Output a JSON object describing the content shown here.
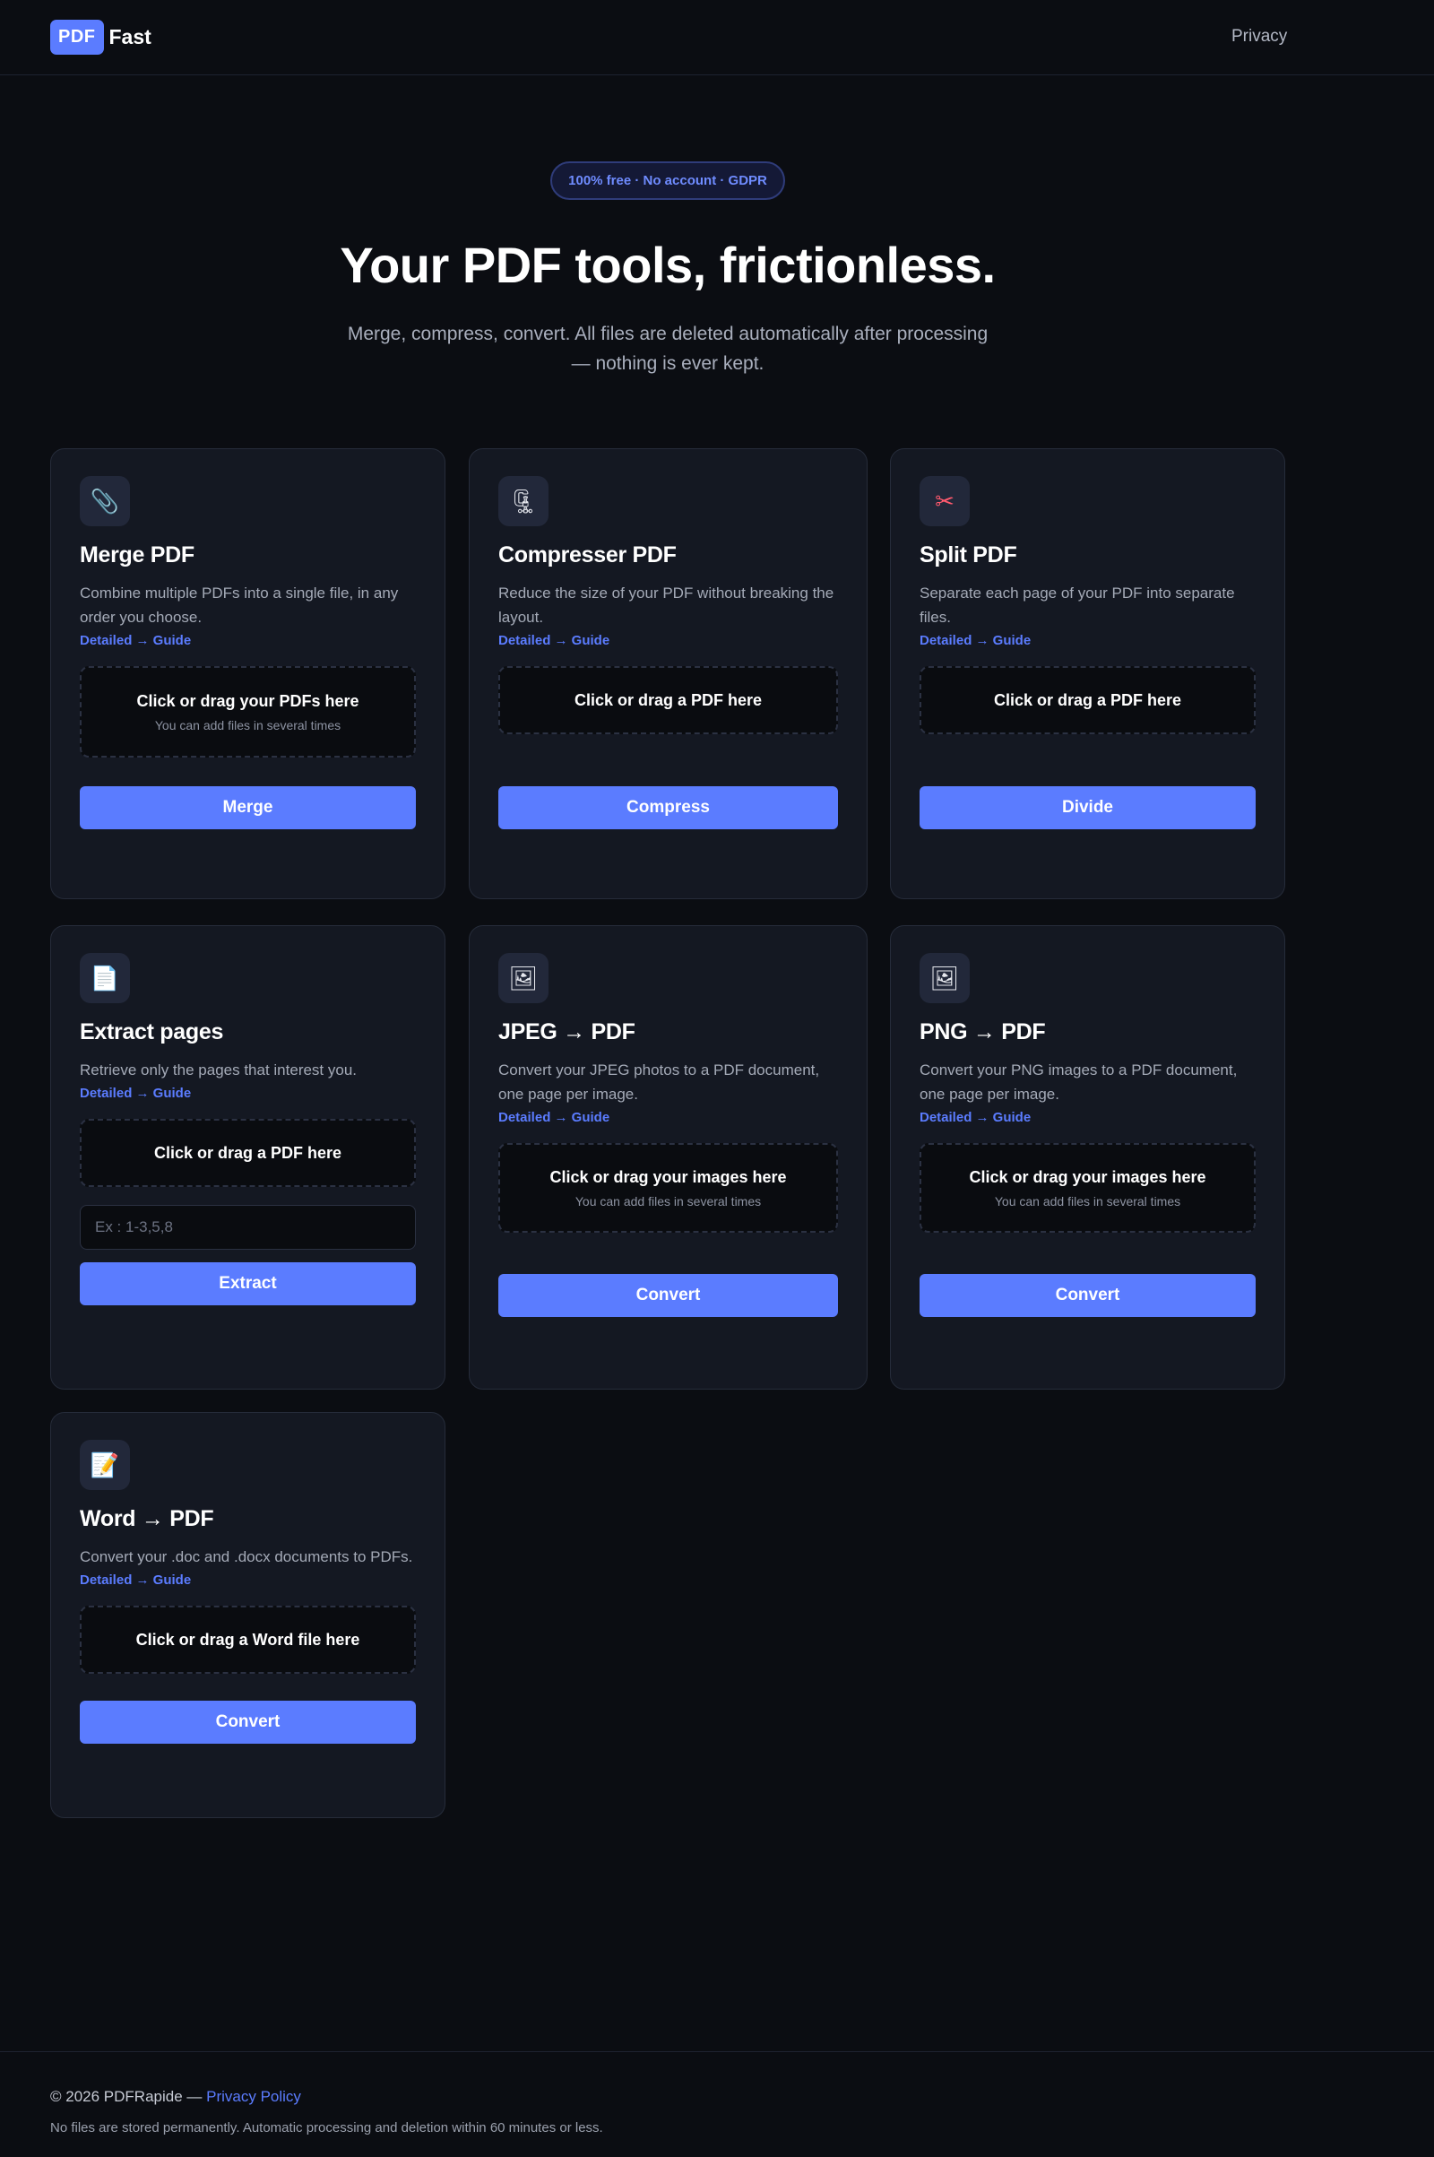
{
  "brand": {
    "badge": "PDF",
    "name": "Fast"
  },
  "nav": {
    "privacy": "Privacy"
  },
  "hero": {
    "pill": "100% free · No account · GDPR",
    "title": "Your PDF tools, frictionless.",
    "subtitle": "Merge, compress, convert. All files are deleted automatically after processing — nothing is ever kept."
  },
  "cards": [
    {
      "icon": "📎",
      "title": "Merge PDF",
      "desc": "Combine multiple PDFs into a single file, in any order you choose.",
      "guide": "Detailed → Guide",
      "drop_main": "Click or drag your PDFs here",
      "drop_sub": "You can add files in several times",
      "button": "Merge"
    },
    {
      "icon": "🗜",
      "title": "Compresser PDF",
      "desc": "Reduce the size of your PDF without breaking the layout.",
      "guide": "Detailed → Guide",
      "drop_main": "Click or drag a PDF here",
      "button": "Compress"
    },
    {
      "icon": "✂",
      "title": "Split PDF",
      "desc": "Separate each page of your PDF into separate files.",
      "guide": "Detailed → Guide",
      "drop_main": "Click or drag a PDF here",
      "button": "Divide"
    },
    {
      "icon": "📄",
      "title": "Extract pages",
      "desc": "Retrieve only the pages that interest you.",
      "guide": "Detailed → Guide",
      "drop_main": "Click or drag a PDF here",
      "input_placeholder": "Ex : 1-3,5,8",
      "button": "Extract"
    },
    {
      "icon": "🖼",
      "title": "JPEG → PDF",
      "desc": "Convert your JPEG photos to a PDF document, one page per image.",
      "guide": "Detailed → Guide",
      "drop_main": "Click or drag your images here",
      "drop_sub": "You can add files in several times",
      "button": "Convert"
    },
    {
      "icon": "🖼",
      "title": "PNG → PDF",
      "desc": "Convert your PNG images to a PDF document, one page per image.",
      "guide": "Detailed → Guide",
      "drop_main": "Click or drag your images here",
      "drop_sub": "You can add files in several times",
      "button": "Convert"
    },
    {
      "icon": "📝",
      "title": "Word → PDF",
      "desc": "Convert your .doc and .docx documents to PDFs.",
      "guide": "Detailed → Guide",
      "drop_main": "Click or drag a Word file here",
      "button": "Convert"
    }
  ],
  "footer": {
    "copyright": "© 2026 PDFRapide — ",
    "privacy_link": "Privacy Policy",
    "note": "No files are stored permanently. Automatic processing and deletion within 60 minutes or less."
  },
  "colors": {
    "accent": "#5b7cff",
    "background": "#0b0d12",
    "card": "#141822"
  }
}
